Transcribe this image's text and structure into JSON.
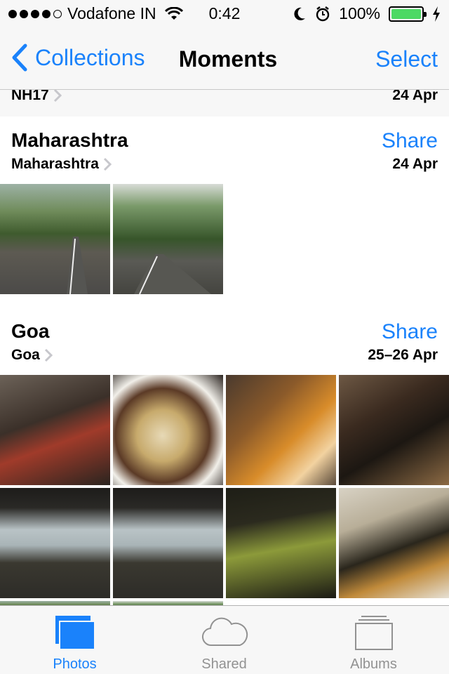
{
  "status_bar": {
    "carrier": "Vodafone IN",
    "time": "0:42",
    "battery": "100%",
    "signal_bars_filled": 4,
    "signal_bars_total": 5
  },
  "nav": {
    "back_label": "Collections",
    "title": "Moments",
    "select_label": "Select"
  },
  "previous_moment": {
    "location": "NH17",
    "date": "24 Apr"
  },
  "moments": [
    {
      "title": "Maharashtra",
      "subtitle": "Maharashtra",
      "date": "24 Apr",
      "share_label": "Share",
      "photo_count": 2
    },
    {
      "title": "Goa",
      "subtitle": "Goa",
      "date": "25–26 Apr",
      "share_label": "Share",
      "photo_count": 8
    }
  ],
  "tabs": [
    {
      "label": "Photos",
      "icon": "photos-icon",
      "active": true
    },
    {
      "label": "Shared",
      "icon": "cloud-icon",
      "active": false
    },
    {
      "label": "Albums",
      "icon": "albums-icon",
      "active": false
    }
  ],
  "colors": {
    "accent": "#1a82fb",
    "battery": "#4cd964",
    "inactive_tab": "#929292"
  }
}
